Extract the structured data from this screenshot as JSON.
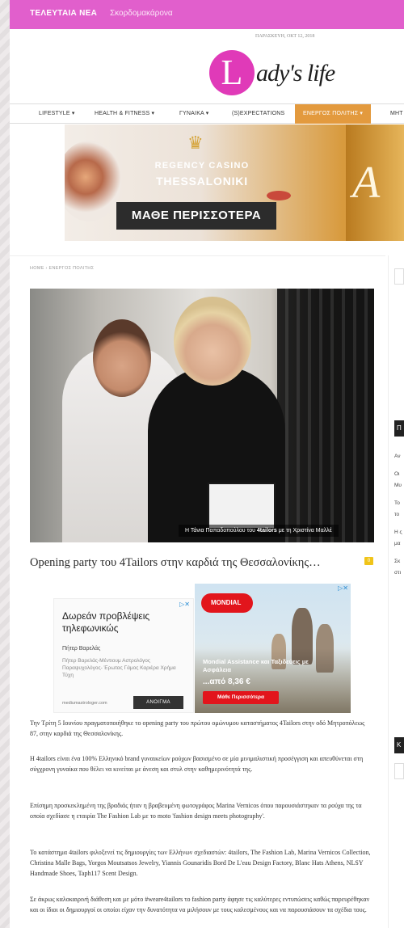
{
  "topbar": {
    "label": "ΤΕΛΕΥΤΑΙΑ ΝΕΑ",
    "ticker": "Σκορδομακάρονα"
  },
  "date": "ΠΑΡΑΣΚΕΥΗ, ΟΚΤ 12, 2018",
  "logo": {
    "letter": "L",
    "text": "ady's life"
  },
  "nav": {
    "items": [
      "LIFESTYLE ▾",
      "HEALTH & FITNESS ▾",
      "ΓΥΝΑΙΚΑ ▾",
      "(S)EXPECTATIONS",
      "ΕΝΕΡΓΟΣ ΠΟΛΙΤΗΣ ▾",
      "ΜΗΤ"
    ],
    "active_index": 4,
    "active_color": "#e39a3e"
  },
  "banner": {
    "line1": "REGENCY CASINO",
    "line2": "THESSALONIKI",
    "cta": "ΜΑΘΕ ΠΕΡΙΣΣΟΤΕΡΑ",
    "side_letter": "A"
  },
  "breadcrumb": "HOME  ›  ΕΝΕΡΓΟΣ ΠΟΛΙΤΗΣ",
  "photo": {
    "caption_pre": "Η Τάνια Παπαδοπούλου του ",
    "caption_bold": "4tailors",
    "caption_post": " με τη Χριστίνα Μαλλέ"
  },
  "article": {
    "title": "Opening party του 4Tailors στην καρδιά της Θεσσαλονίκης…",
    "comments": "0",
    "paragraphs": [
      "Την Τρίτη 5 Ιουνίου πραγματοποιήθηκε το opening party του πρώτου ομώνυμου καταστήματος 4Tailors στην οδό Μητροπόλεως 87, στην καρδιά της Θεσσαλονίκης.",
      "Η 4tailors είναι ένα 100% Ελληνικό brand γυναικείων ρούχων βασισμένο σε μία μινιμαλιστική προσέγγιση και απευθύνεται στη σύγχρονη γυναίκα που θέλει να κινείται με άνεση και στυλ στην καθημερινότητά της.",
      "Επίσημη προσκεκλημένη της βραδιάς ήταν η βραβευμένη φωτογράφος Marina Vernicos όπου παρουσιάστηκαν τα ρούχα της τα οποία σχεδίασε η εταιρία The Fashion Lab με το moto 'fashion design meets photography'.",
      "Το κατάστημα 4tailors φιλοξενεί τις δημιουργίες των Ελλήνων σχεδιαστών: 4tailors, The Fashion Lab, Marina Vernicos Collection, Christina Malle Bags, Yorgos Moutsatsos Jewelry, Yiannis Gounaridis Bord De L'eau Design Factory, Blanc Hats Athens, NLSY Handmade Shoes, Taph117 Scent Design.",
      "Σε άκρως καλοκαιρινή διάθεση και με μότο #weare4tailors το fashion party άφησε τις καλύτερες εντυπώσεις καθώς παρευρέθηκαν και οι ίδιοι οι δημιουργοί οι οποίοι είχαν την δυνατότητα να μιλήσουν με τους καλεσμένους και να παρουσιάσουν τα σχέδια τους."
    ]
  },
  "ad1": {
    "title": "Δωρεάν προβλέψεις τηλεφωνικώς",
    "name": "Πήτερ Βαρελάς",
    "desc": "Πήτερ Βαρελάς-Μέντιουμ Αστρολόγος Παραψυχολόγος- Έρωτας Γάμος Καριέρα Χρήμα Τύχη",
    "url": "mediumastrologer.com",
    "button": "ΑΝΟΙΓΜΑ"
  },
  "ad2": {
    "brand": "MONDIAL",
    "brand_sub": "ASSISTANCE",
    "line1": "Mondial Assistance και Ταξιδεύεις με Ασφάλεια",
    "price": "...από 8,36 €",
    "cta": "Μάθε Περισσότερα"
  },
  "sidebar": {
    "label1": "Π",
    "items": [
      "Αν",
      "Οι",
      "Μυ",
      "Το",
      "το",
      "Η ς",
      "μα",
      "Σκ",
      "στι"
    ],
    "label2": "Κ"
  }
}
